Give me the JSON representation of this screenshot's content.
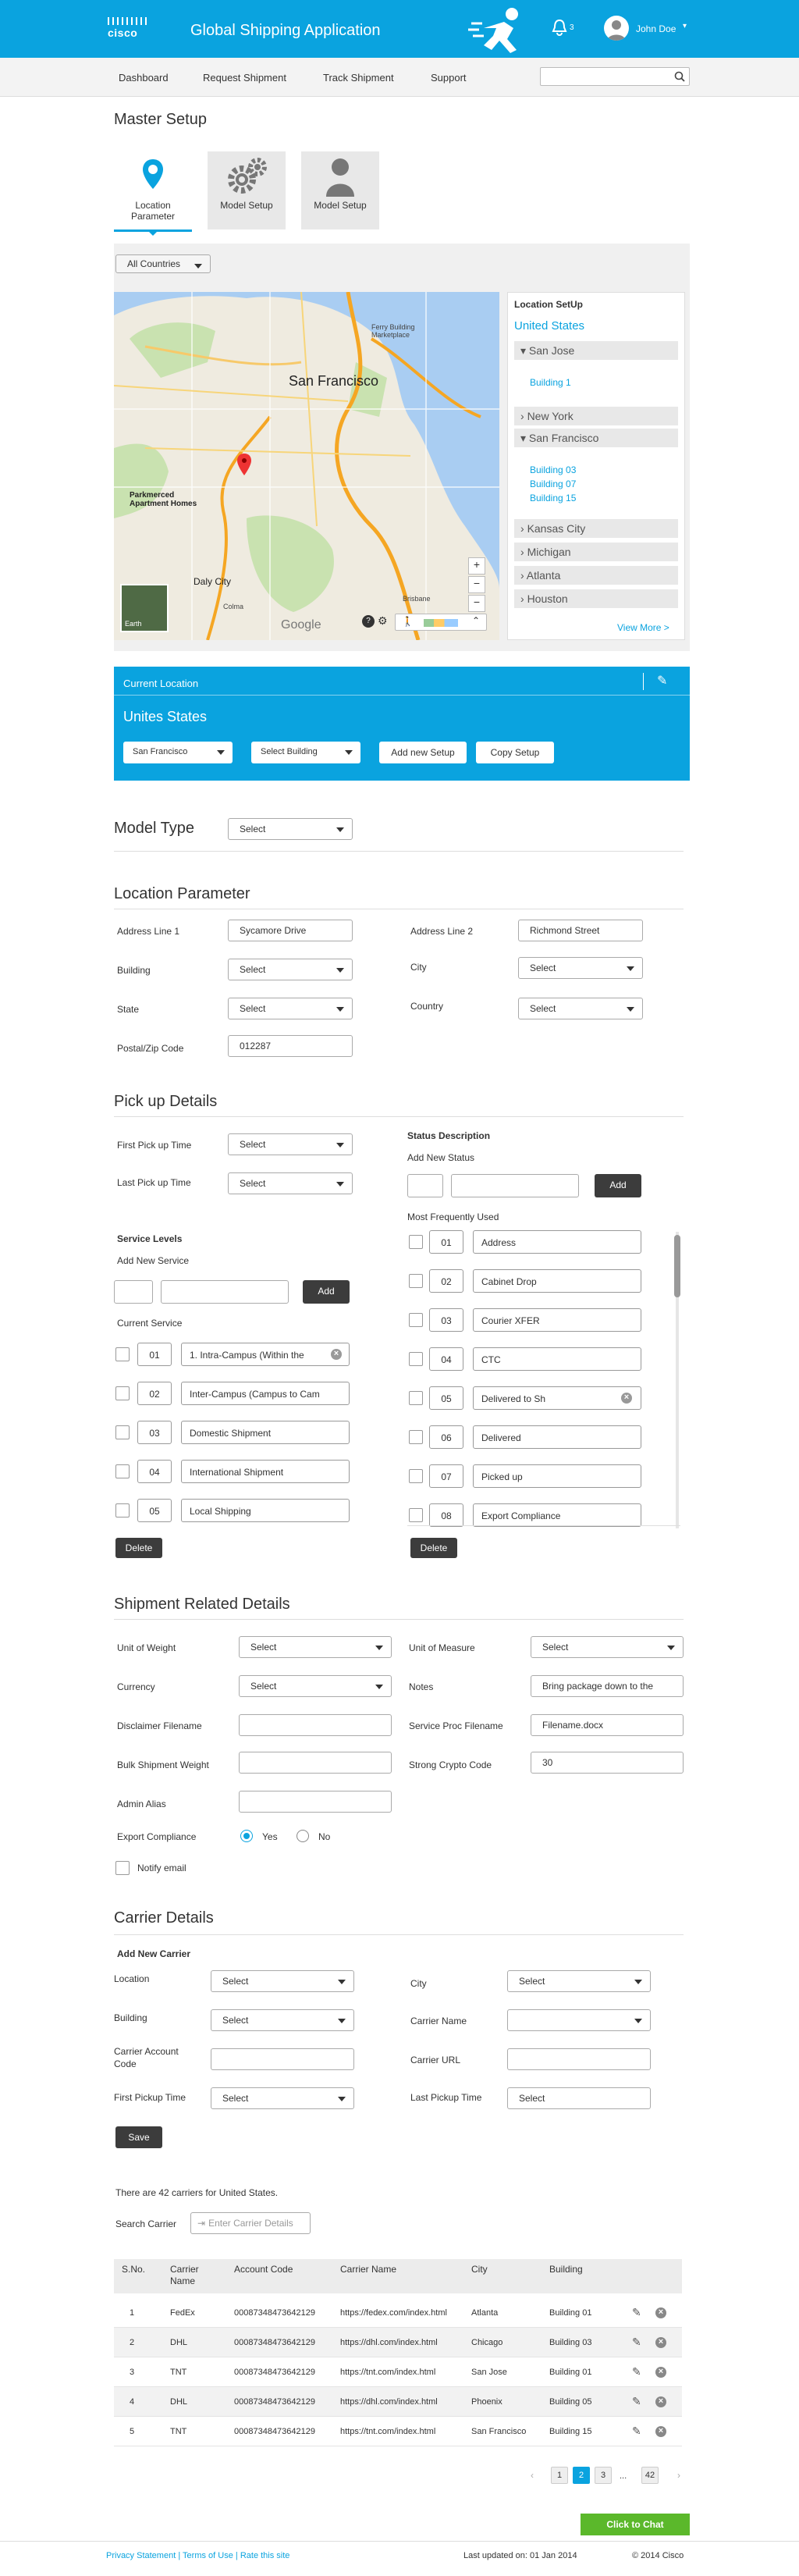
{
  "header": {
    "brand": "cisco",
    "title": "Global Shipping Application",
    "notif_count": "3",
    "user": "John Doe"
  },
  "nav": [
    "Dashboard",
    "Request Shipment",
    "Track Shipment",
    "Support"
  ],
  "master": {
    "title": "Master Setup",
    "tiles": [
      "Location Parameter",
      "Model Setup",
      "Model Setup"
    ],
    "countries": "All Countries"
  },
  "locpanel": {
    "title": "Location SetUp",
    "country": "United States",
    "cities": [
      {
        "name": "San Jose",
        "open": true,
        "buildings": [
          "Building 1"
        ]
      },
      {
        "name": "New York"
      },
      {
        "name": "San Francisco",
        "open": true,
        "buildings": [
          "Building 03",
          "Building 07",
          "Building 15"
        ]
      },
      {
        "name": "Kansas City"
      },
      {
        "name": "Michigan"
      },
      {
        "name": "Atlanta"
      },
      {
        "name": "Houston"
      }
    ],
    "view_more": "View More >"
  },
  "map": {
    "city": "San Francisco",
    "daly": "Daly City",
    "marker": "Parkmerced Apartment Homes",
    "ferry": "Ferry Building Marketplace",
    "brisbane": "Brisbane",
    "colma": "Colma",
    "google": "Google",
    "earth": "Earth"
  },
  "current": {
    "title": "Current Location",
    "country": "Unites States",
    "city": "San Francisco",
    "building": "Select Building",
    "add": "Add new Setup",
    "copy": "Copy Setup"
  },
  "model_type": {
    "title": "Model Type",
    "value": "Select"
  },
  "location_param": {
    "title": "Location Parameter",
    "addr1_label": "Address Line 1",
    "addr1": "Sycamore Drive",
    "addr2_label": "Address Line 2",
    "addr2": "Richmond Street",
    "building_label": "Building",
    "city_label": "City",
    "state_label": "State",
    "country_label": "Country",
    "zip_label": "Postal/Zip Code",
    "zip": "012287",
    "select": "Select"
  },
  "pickup": {
    "title": "Pick up Details",
    "first": "First Pick up Time",
    "last": "Last Pick up Time",
    "select": "Select",
    "service_title": "Service Levels",
    "add_service": "Add New Service",
    "add": "Add",
    "current_service": "Current Service",
    "services": [
      [
        "01",
        "1. Intra-Campus (Within the"
      ],
      [
        "02",
        "Inter-Campus (Campus to Cam"
      ],
      [
        "03",
        "Domestic Shipment"
      ],
      [
        "04",
        "International Shipment"
      ],
      [
        "05",
        "Local Shipping"
      ]
    ],
    "delete": "Delete",
    "status_title": "Status Description",
    "add_status": "Add New Status",
    "freq": "Most Frequently Used",
    "statuses": [
      [
        "01",
        "Address"
      ],
      [
        "02",
        "Cabinet Drop"
      ],
      [
        "03",
        "Courier XFER"
      ],
      [
        "04",
        "CTC"
      ],
      [
        "05",
        "Delivered to Sh"
      ],
      [
        "06",
        "Delivered"
      ],
      [
        "07",
        "Picked up"
      ],
      [
        "08",
        "Export Compliance"
      ]
    ]
  },
  "shipment": {
    "title": "Shipment Related Details",
    "uow": "Unit of Weight",
    "uom": "Unit of Measure",
    "currency": "Currency",
    "notes": "Notes",
    "notes_val": "Bring package down to the",
    "disc": "Disclaimer Filename",
    "spf": "Service Proc Filename",
    "spf_val": "Filename.docx",
    "bulk": "Bulk Shipment Weight",
    "crypto": "Strong Crypto Code",
    "crypto_val": "30",
    "admin": "Admin Alias",
    "export": "Export Compliance",
    "yes": "Yes",
    "no": "No",
    "notify": "Notify email",
    "select": "Select"
  },
  "carrier": {
    "title": "Carrier Details",
    "add_title": "Add New Carrier",
    "location": "Location",
    "city": "City",
    "building": "Building",
    "carrier_name": "Carrier Name",
    "account": "Carrier Account Code",
    "url": "Carrier URL",
    "first": "First Pickup Time",
    "last": "Last Pickup Time",
    "select": "Select",
    "save": "Save",
    "count_text": "There are  42 carriers for United States.",
    "search_label": "Search Carrier",
    "search_ph": "Enter Carrier Details",
    "cols": [
      "S.No.",
      "Carrier Name",
      "Account Code",
      "Carrier Name",
      "City",
      "Building"
    ],
    "rows": [
      [
        "1",
        "FedEx",
        "00087348473642129",
        "https://fedex.com/index.html",
        "Atlanta",
        "Building 01"
      ],
      [
        "2",
        "DHL",
        "00087348473642129",
        "https://dhl.com/index.html",
        "Chicago",
        "Building 03"
      ],
      [
        "3",
        "TNT",
        "00087348473642129",
        "https://tnt.com/index.html",
        "San Jose",
        "Building 01"
      ],
      [
        "4",
        "DHL",
        "00087348473642129",
        "https://dhl.com/index.html",
        "Phoenix",
        "Building 05"
      ],
      [
        "5",
        "TNT",
        "00087348473642129",
        "https://tnt.com/index.html",
        "San Francisco",
        "Building 15"
      ]
    ],
    "pages": [
      "1",
      "2",
      "3",
      "...",
      "42"
    ]
  },
  "chat": "Click to Chat",
  "footer": {
    "privacy": "Privacy Statement",
    "terms": "Terms of Use",
    "rate": "Rate this site",
    "updated": "Last updated on: 01 Jan 2014",
    "copy": "© 2014 Cisco"
  },
  "colors": {
    "brand": "#0aa3df",
    "dark_button": "#3c3c3c",
    "chat": "#5bb82b"
  }
}
